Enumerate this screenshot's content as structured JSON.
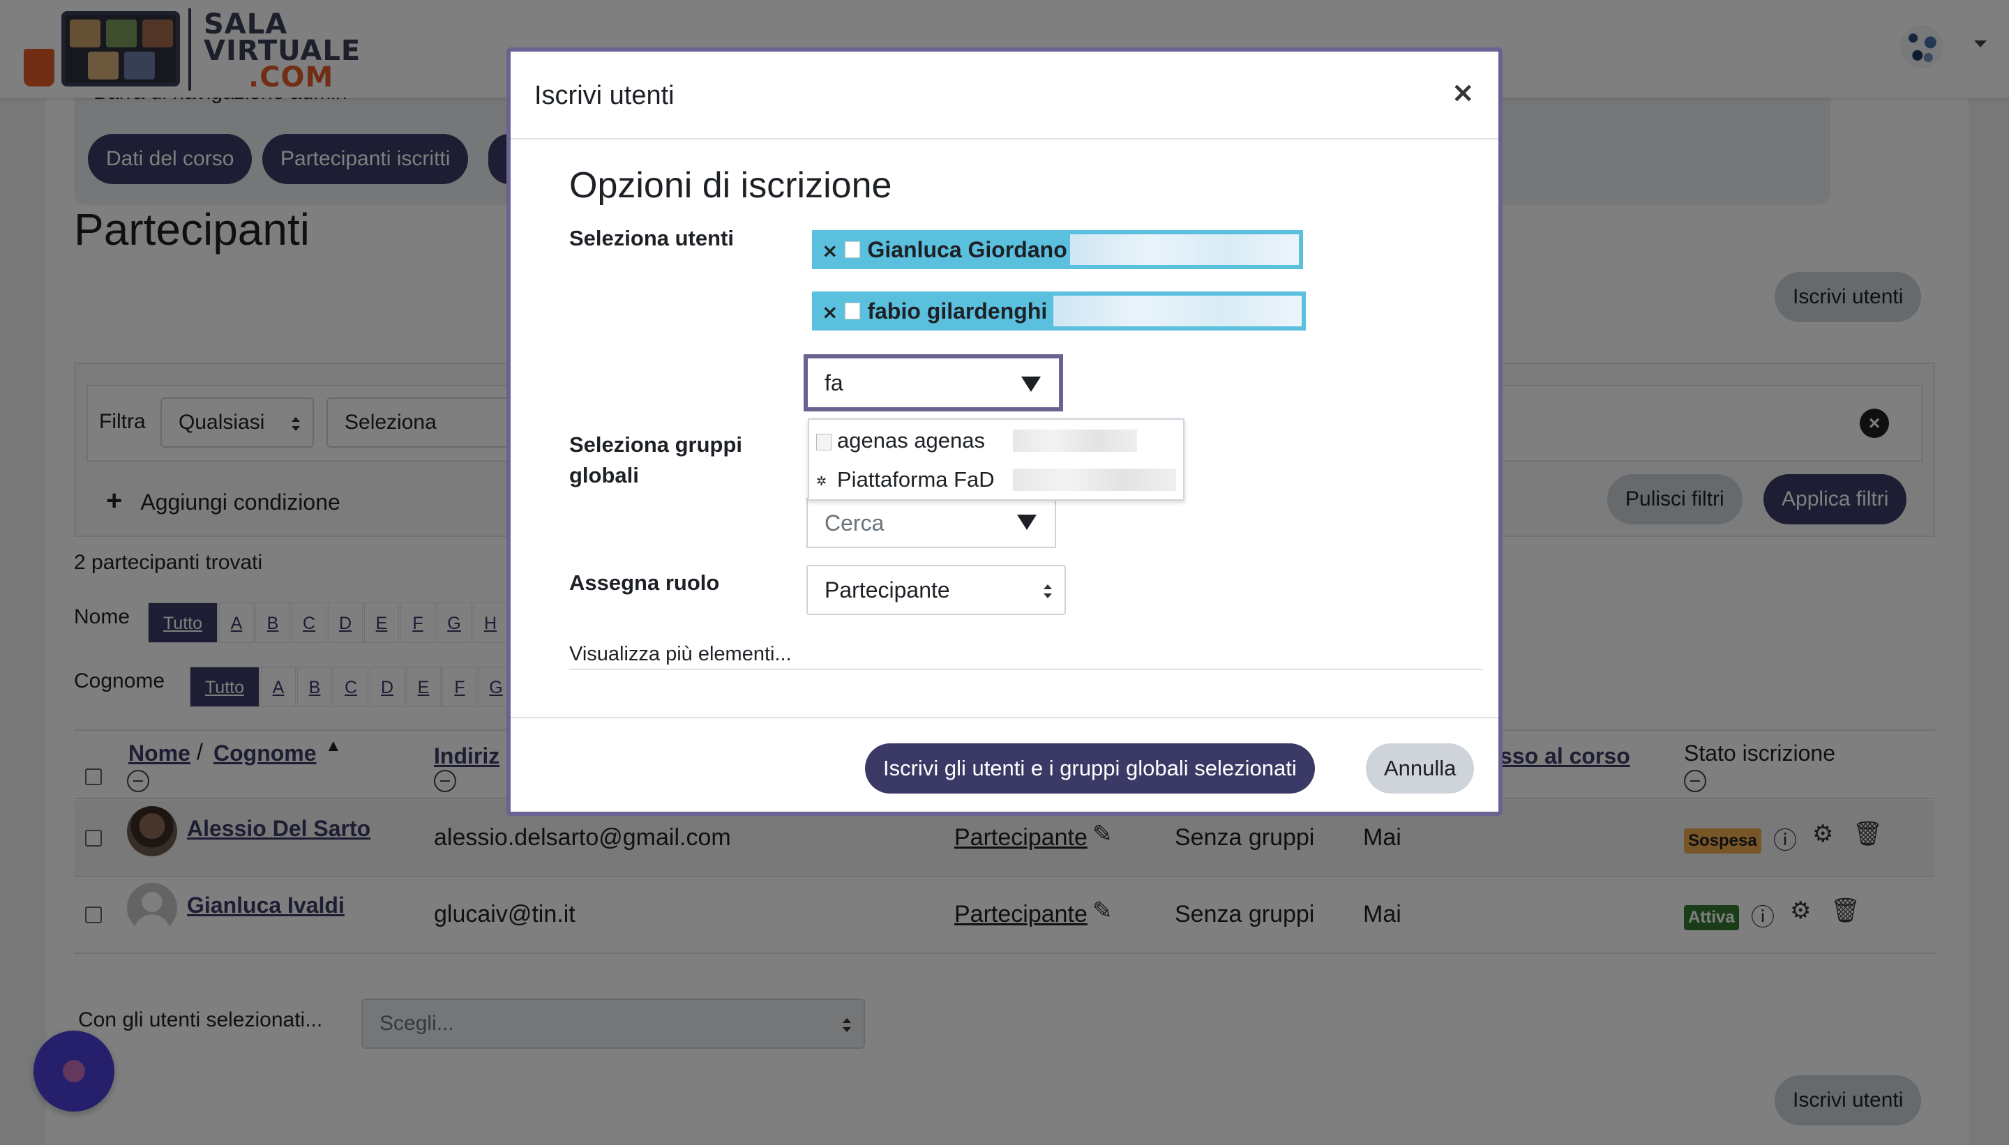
{
  "brand": {
    "line1": "SALA",
    "line2": "VIRTUALE",
    "line3": ".COM"
  },
  "nav_admin": {
    "title": "Barra di navigazione admin",
    "items": [
      "Dati del corso",
      "Partecipanti iscritti"
    ]
  },
  "page": {
    "title": "Partecipanti",
    "enrol_button": "Iscrivi utenti",
    "enrol_button_bottom": "Iscrivi utenti"
  },
  "filter": {
    "label": "Filtra",
    "match_value": "Qualsiasi",
    "type_value": "Seleziona",
    "add_condition": "Aggiungi condizione",
    "clear": "Pulisci filtri",
    "apply": "Applica filtri"
  },
  "results": {
    "count_text": "2 partecipanti trovati",
    "first_name_label": "Nome",
    "last_name_label": "Cognome",
    "all": "Tutto",
    "letters_first": [
      "A",
      "B",
      "C",
      "D",
      "E",
      "F",
      "G",
      "H"
    ],
    "letters_last": [
      "A",
      "B",
      "C",
      "D",
      "E",
      "F",
      "G"
    ]
  },
  "table": {
    "col_name": "Nome",
    "col_surname": "Cognome",
    "col_email": "Indiriz",
    "col_access": "sso al corso",
    "col_status": "Stato iscrizione",
    "rows": [
      {
        "name": "Alessio Del Sarto",
        "email": "alessio.delsarto@gmail.com",
        "role": "Partecipante",
        "groups": "Senza gruppi",
        "last_access": "Mai",
        "status": "Sospesa"
      },
      {
        "name": "Gianluca Ivaldi",
        "email": "glucaiv@tin.it",
        "role": "Partecipante",
        "groups": "Senza gruppi",
        "last_access": "Mai",
        "status": "Attiva"
      }
    ]
  },
  "bulk": {
    "label": "Con gli utenti selezionati...",
    "placeholder": "Scegli..."
  },
  "modal": {
    "title": "Iscrivi utenti",
    "close": "×",
    "section_title": "Opzioni di iscrizione",
    "select_users_label": "Seleziona utenti",
    "selected_users": [
      "Gianluca Giordano",
      "fabio gilardenghi"
    ],
    "search_value": "fa",
    "suggestions": [
      "agenas agenas",
      "Piattaforma FaD"
    ],
    "select_groups_label": "Seleziona gruppi globali",
    "groups_placeholder": "Cerca",
    "assign_role_label": "Assegna ruolo",
    "role_value": "Partecipante",
    "show_more": "Visualizza più elementi...",
    "submit": "Iscrivi gli utenti e i gruppi globali selezionati",
    "cancel": "Annulla"
  },
  "colors": {
    "primary": "#3b3a66",
    "chip": "#5bc0de",
    "badge_suspended": "#f0ad4e",
    "badge_active": "#357a32",
    "accent_orange": "#e35d2a"
  }
}
